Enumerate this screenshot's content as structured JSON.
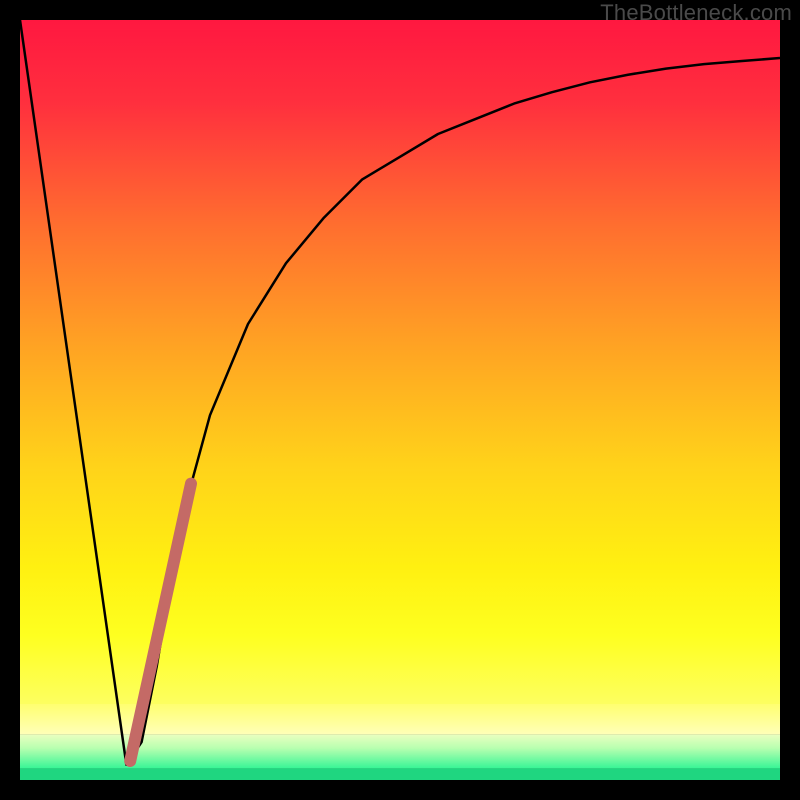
{
  "watermark": "TheBottleneck.com",
  "chart_data": {
    "type": "line",
    "title": "",
    "xlabel": "",
    "ylabel": "",
    "xlim": [
      0,
      100
    ],
    "ylim": [
      0,
      100
    ],
    "grid": false,
    "series": [
      {
        "name": "curve",
        "color": "#000000",
        "stroke_width": 2.5,
        "x": [
          0,
          14,
          16,
          18,
          20,
          22,
          25,
          30,
          35,
          40,
          45,
          50,
          55,
          60,
          65,
          70,
          75,
          80,
          85,
          90,
          95,
          100
        ],
        "y": [
          100,
          2,
          5,
          15,
          27,
          37,
          48,
          60,
          68,
          74,
          79,
          82,
          85,
          87,
          89,
          90.5,
          91.8,
          92.8,
          93.6,
          94.2,
          94.6,
          95
        ]
      },
      {
        "name": "highlight-segment",
        "color": "#c46a66",
        "stroke_width": 12,
        "x": [
          14.5,
          22.5
        ],
        "y": [
          2.5,
          39
        ]
      }
    ],
    "background_bands": [
      {
        "y0": 100,
        "y1": 10,
        "gradient": [
          "#ff1a3e",
          "#ffef00"
        ]
      },
      {
        "y0": 10,
        "y1": 6,
        "gradient": [
          "#ffff66",
          "#ffffaa"
        ]
      },
      {
        "y0": 6,
        "y1": 1.5,
        "gradient": [
          "#d8ff9e",
          "#3ff093"
        ]
      },
      {
        "y0": 1.5,
        "y1": 0,
        "color": "#1fd680"
      }
    ]
  }
}
